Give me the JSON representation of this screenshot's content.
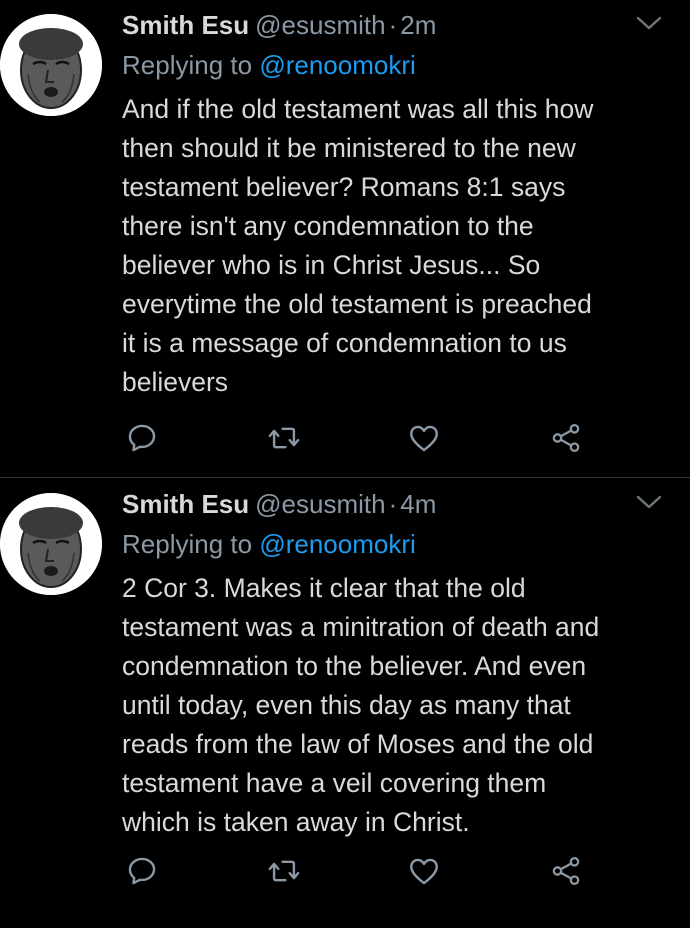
{
  "tweets": [
    {
      "display_name": "Smith Esu",
      "handle": "@esusmith",
      "separator": "·",
      "time": "2m",
      "replying_prefix": "Replying to",
      "replying_to": "@renoomokri",
      "body_lines": [
        "And if the old testament was all this how",
        "then should it be ministered to the new",
        "testament believer? Romans 8:1 says",
        "there isn't any condemnation to the",
        "believer who is in Christ Jesus... So",
        "everytime the old testament is preached",
        "it is a message of condemnation to us",
        "believers"
      ],
      "actions": [
        "reply-icon",
        "retweet-icon",
        "like-icon",
        "share-icon"
      ]
    },
    {
      "display_name": "Smith Esu",
      "handle": "@esusmith",
      "separator": "·",
      "time": "4m",
      "replying_prefix": "Replying to",
      "replying_to": "@renoomokri",
      "body_lines": [
        "2 Cor 3. Makes it clear that the old",
        "testament was a minitration of death and",
        "condemnation to the believer. And even",
        "until today, even this day as many that",
        "reads from the law of Moses and the old",
        "testament have a veil covering them",
        "which is taken away in Christ."
      ],
      "actions": [
        "reply-icon",
        "retweet-icon",
        "like-icon",
        "share-icon"
      ]
    }
  ],
  "colors": {
    "background": "#000000",
    "text_primary": "#d9d9d9",
    "text_secondary": "#8b98a5",
    "link": "#1d9bf0",
    "divider": "#2f3336"
  }
}
